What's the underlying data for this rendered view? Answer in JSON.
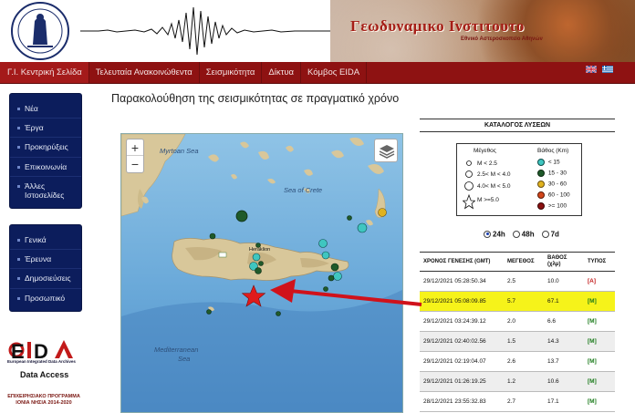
{
  "header": {
    "title": "Γεωδυναμικο Ινστιτουτο",
    "subtitle": "Εθνικό Αστεροσκοπείο Αθηνών"
  },
  "nav": {
    "items": [
      {
        "label": "Γ.Ι. Κεντρική Σελίδα",
        "active": true
      },
      {
        "label": "Τελευταία Ανακοινώθεντα",
        "active": false
      },
      {
        "label": "Σεισμικότητα",
        "active": false
      },
      {
        "label": "Δίκτυα",
        "active": false
      },
      {
        "label": "Κόμβος EIDA",
        "active": false
      }
    ],
    "flags": [
      "uk-flag-icon",
      "greek-flag-icon"
    ]
  },
  "sidebar": {
    "group1": [
      "Νέα",
      "Έργα",
      "Προκηρύξεις",
      "Επικοινωνία",
      "Άλλες Ιστοσελίδες"
    ],
    "group2": [
      "Γενικά",
      "Έρευνα",
      "Δημοσιεύσεις",
      "Προσωπικό"
    ],
    "eida_caption": "European Integrated Data Archives",
    "data_access": "Data Access",
    "program_text": "ΕΠΙΧΕΙΡΗΣΙΑΚΟ ΠΡΟΓΡΑΜΜΑ ΙΟΝΙΑ ΝΗΣΙΑ 2014-2020"
  },
  "main": {
    "page_title": "Παρακολούθηση της σεισμικότητας σε πραγματικό χρόνο"
  },
  "map": {
    "labels": {
      "myrtoan": "Myrtoan Sea",
      "crete_sea": "Sea of Crete",
      "heraklion": "Heraklion",
      "mediterranean": "Mediterranean",
      "sea": "Sea"
    },
    "zoom_in": "+",
    "zoom_out": "−"
  },
  "catalog": {
    "title": "ΚΑΤΑΛΟΓΟΣ ΛΥΣΕΩΝ",
    "legend": {
      "magnitude_title": "Μέγεθος",
      "depth_title": "Βάθος (Km)",
      "magnitudes": [
        "M < 2.5",
        "2.5< M < 4.0",
        "4.0< M < 5.0",
        "M >=5.0"
      ],
      "depths": [
        {
          "label": "< 15",
          "color": "#3fc6c0"
        },
        {
          "label": "15 - 30",
          "color": "#1f5a2a"
        },
        {
          "label": "30 - 60",
          "color": "#e0b21e"
        },
        {
          "label": "60 - 100",
          "color": "#d2461a"
        },
        {
          "label": ">= 100",
          "color": "#8a1010"
        }
      ]
    },
    "ranges": [
      {
        "label": "24h",
        "selected": true
      },
      {
        "label": "48h",
        "selected": false
      },
      {
        "label": "7d",
        "selected": false
      }
    ],
    "columns": [
      "ΧΡΟΝΟΣ ΓΕΝΕΣΗΣ (GMT)",
      "ΜΕΓΕΘΟΣ",
      "ΒΑΘΟΣ (χλμ)",
      "ΤΥΠΟΣ"
    ],
    "rows": [
      {
        "time": "29/12/2021 05:28:50.34",
        "mag": "2.5",
        "depth": "10.0",
        "type": "[A]",
        "highlight": false
      },
      {
        "time": "29/12/2021 05:08:09.85",
        "mag": "5.7",
        "depth": "67.1",
        "type": "[M]",
        "highlight": true
      },
      {
        "time": "29/12/2021 03:24:39.12",
        "mag": "2.0",
        "depth": "6.6",
        "type": "[M]",
        "highlight": false
      },
      {
        "time": "29/12/2021 02:40:02.56",
        "mag": "1.5",
        "depth": "14.3",
        "type": "[M]",
        "highlight": false
      },
      {
        "time": "29/12/2021 02:19:04.07",
        "mag": "2.6",
        "depth": "13.7",
        "type": "[M]",
        "highlight": false
      },
      {
        "time": "29/12/2021 01:26:19.25",
        "mag": "1.2",
        "depth": "10.6",
        "type": "[M]",
        "highlight": false
      },
      {
        "time": "28/12/2021 23:55:32.83",
        "mag": "2.7",
        "depth": "17.1",
        "type": "[M]",
        "highlight": false
      }
    ]
  }
}
